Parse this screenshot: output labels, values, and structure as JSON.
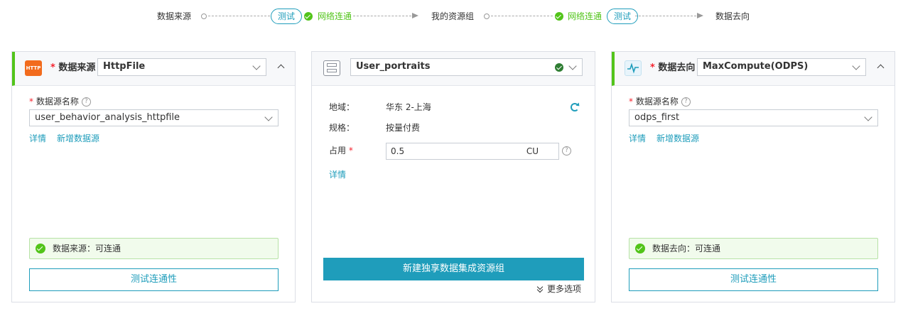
{
  "flow": {
    "step1": "数据来源",
    "test_pill_1": "测试",
    "net1": "网络连通",
    "step2": "我的资源组",
    "net2": "网络连通",
    "test_pill_2": "测试",
    "step3": "数据去向",
    "accent_color": "#52c41a",
    "link_color": "#1f9dbb"
  },
  "source": {
    "logo_text": "HTTP",
    "required_mark": "*",
    "label": "数据来源",
    "type_value": "HttpFile",
    "ds_name_label": "数据源名称",
    "ds_name_value": "user_behavior_analysis_httpfile",
    "detail_link": "详情",
    "new_ds_link": "新增数据源",
    "status_text": "数据来源：可连通",
    "test_button": "测试连通性"
  },
  "resource": {
    "group_value": "User_portraits",
    "region_label": "地域：",
    "region_value": "华东 2-上海",
    "spec_label": "规格：",
    "spec_value": "按量付费",
    "occupy_label": "占用",
    "required_mark": "*",
    "occupy_value": "0.5",
    "occupy_unit": "CU",
    "detail_link": "详情",
    "create_button": "新建独享数据集成资源组",
    "more_options": "更多选项"
  },
  "target": {
    "required_mark": "*",
    "label": "数据去向",
    "type_value": "MaxCompute(ODPS)",
    "ds_name_label": "数据源名称",
    "ds_name_value": "odps_first",
    "detail_link": "详情",
    "new_ds_link": "新增数据源",
    "status_text": "数据去向：可连通",
    "test_button": "测试连通性"
  }
}
